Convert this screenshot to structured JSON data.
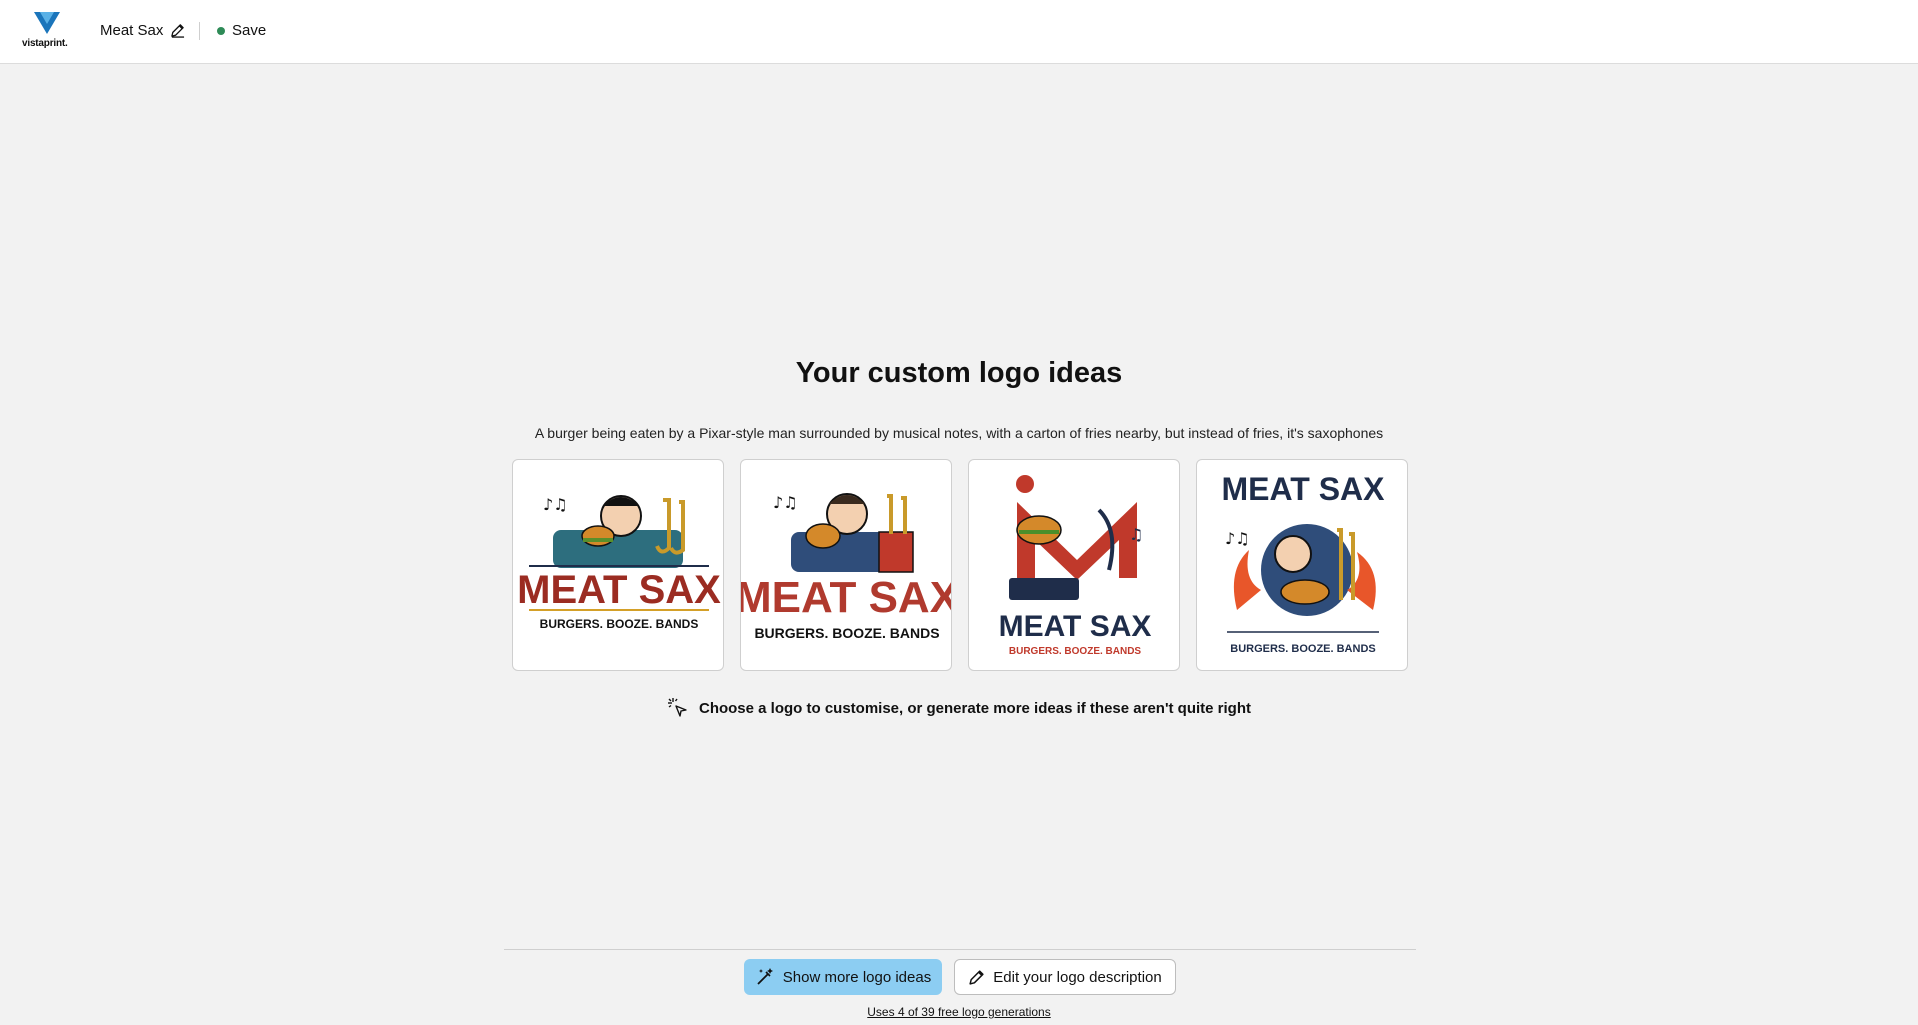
{
  "header": {
    "brand": "vistaprint.",
    "project_name": "Meat Sax",
    "save_label": "Save"
  },
  "main": {
    "title": "Your custom logo ideas",
    "description": "A burger being eaten by a Pixar-style man surrounded by musical notes, with a carton of fries nearby, but instead of fries, it's saxophones",
    "logo_options": [
      {
        "headline": "MEAT SAX",
        "tagline": "BURGERS. BOOZE. BANDS"
      },
      {
        "headline": "MEAT SAX",
        "tagline": "BURGERS. BOOZE. BANDS"
      },
      {
        "headline": "MEAT SAX",
        "tagline": "BURGERS. BOOZE. BANDS"
      },
      {
        "headline": "MEAT SAX",
        "tagline": "BURGERS. BOOZE. BANDS"
      }
    ],
    "hint": "Choose a logo to customise, or generate more ideas if these aren't quite right"
  },
  "footer": {
    "show_more_label": "Show more logo ideas",
    "edit_description_label": "Edit your logo description",
    "usage_text": "Uses 4 of 39 free logo generations"
  },
  "colors": {
    "accent": "#8ccdf2",
    "save_status": "#2e8b57",
    "logo_red": "#b03a2e",
    "logo_navy": "#1f2d4a"
  },
  "icons": {
    "project_edit": "pencil-icon",
    "save_status": "status-dot-icon",
    "hint": "sparkle-cursor-icon",
    "show_more": "magic-wand-icon",
    "edit_description": "pencil-icon"
  }
}
